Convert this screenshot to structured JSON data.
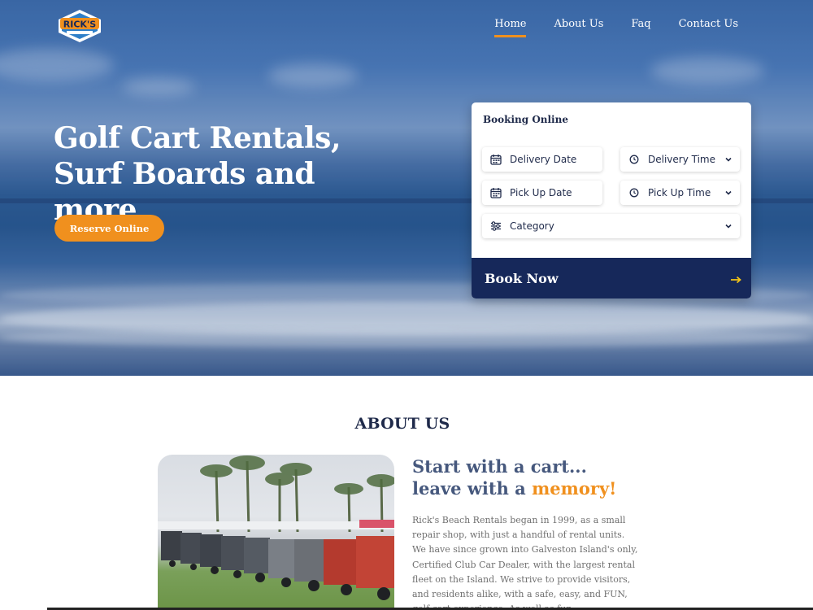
{
  "brand": {
    "logo_text": "RICK'S",
    "logo_colors": {
      "orange": "#f0901e",
      "navy": "#16285a",
      "blue": "#2f7fc8"
    }
  },
  "nav": {
    "items": [
      {
        "label": "Home",
        "active": true
      },
      {
        "label": "About Us",
        "active": false
      },
      {
        "label": "Faq",
        "active": false
      },
      {
        "label": "Contact Us",
        "active": false
      }
    ]
  },
  "hero": {
    "title": "Golf Cart Rentals, Surf Boards and more",
    "reserve_button": "Reserve Online"
  },
  "booking": {
    "title": "Booking Online",
    "fields": {
      "delivery_date": {
        "label": "Delivery Date",
        "icon": "calendar-icon"
      },
      "delivery_time": {
        "label": "Delivery Time",
        "icon": "clock-icon"
      },
      "pickup_date": {
        "label": "Pick Up Date",
        "icon": "calendar-icon"
      },
      "pickup_time": {
        "label": "Pick Up Time",
        "icon": "clock-icon"
      },
      "category": {
        "label": "Category",
        "icon": "sliders-icon"
      }
    },
    "book_button": "Book Now"
  },
  "about": {
    "heading": "ABOUT US",
    "sub_line1": "Start with a cart...",
    "sub_line2_prefix": "leave with a ",
    "sub_line2_accent": "memory!",
    "body": "Rick's Beach Rentals began in 1999, as a small repair shop, with just a handful of rental units. We have since grown into Galveston Island's only, Certified Club Car Dealer, with the largest rental fleet on the Island. We strive to provide visitors, and residents alike, with a safe, easy, and FUN, golf cart experience. As well as fun"
  },
  "colors": {
    "accent": "#f0901e",
    "navy": "#16285a",
    "heading": "#1f2a4a",
    "subheading": "#46587d"
  }
}
